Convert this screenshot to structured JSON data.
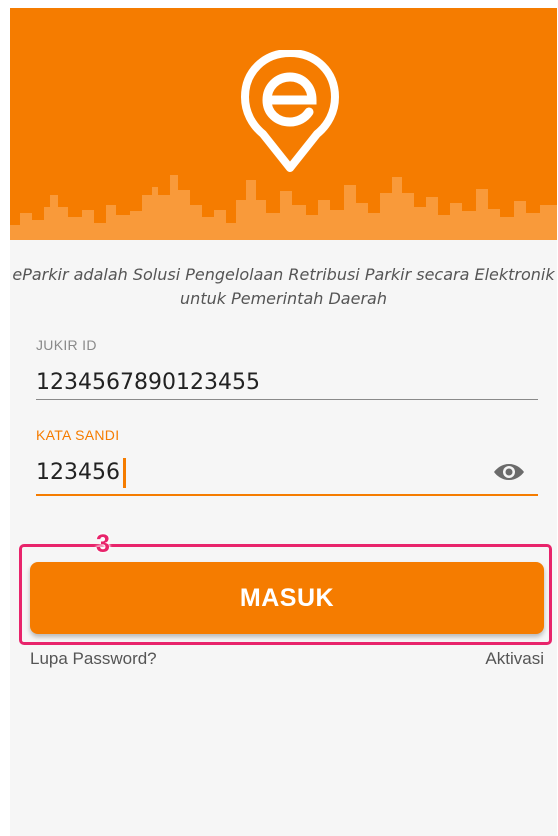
{
  "header": {
    "logo_icon": "eparkir-logo-icon",
    "background_color": "#f57c00"
  },
  "tagline": "eParkir adalah Solusi Pengelolaan Retribusi Parkir secara Elektronik untuk Pemerintah Daerah",
  "form": {
    "jukir_id": {
      "label": "JUKIR ID",
      "value": "1234567890123455"
    },
    "kata_sandi": {
      "label": "KATA SANDI",
      "value": "123456",
      "toggle_icon": "eye-icon"
    }
  },
  "annotation": {
    "step_number": "3",
    "color": "#e8246b"
  },
  "submit_button": {
    "label": "MASUK"
  },
  "links": {
    "forgot_password": "Lupa Password?",
    "activation": "Aktivasi"
  },
  "colors": {
    "accent": "#f57c00",
    "highlight": "#e8246b"
  }
}
